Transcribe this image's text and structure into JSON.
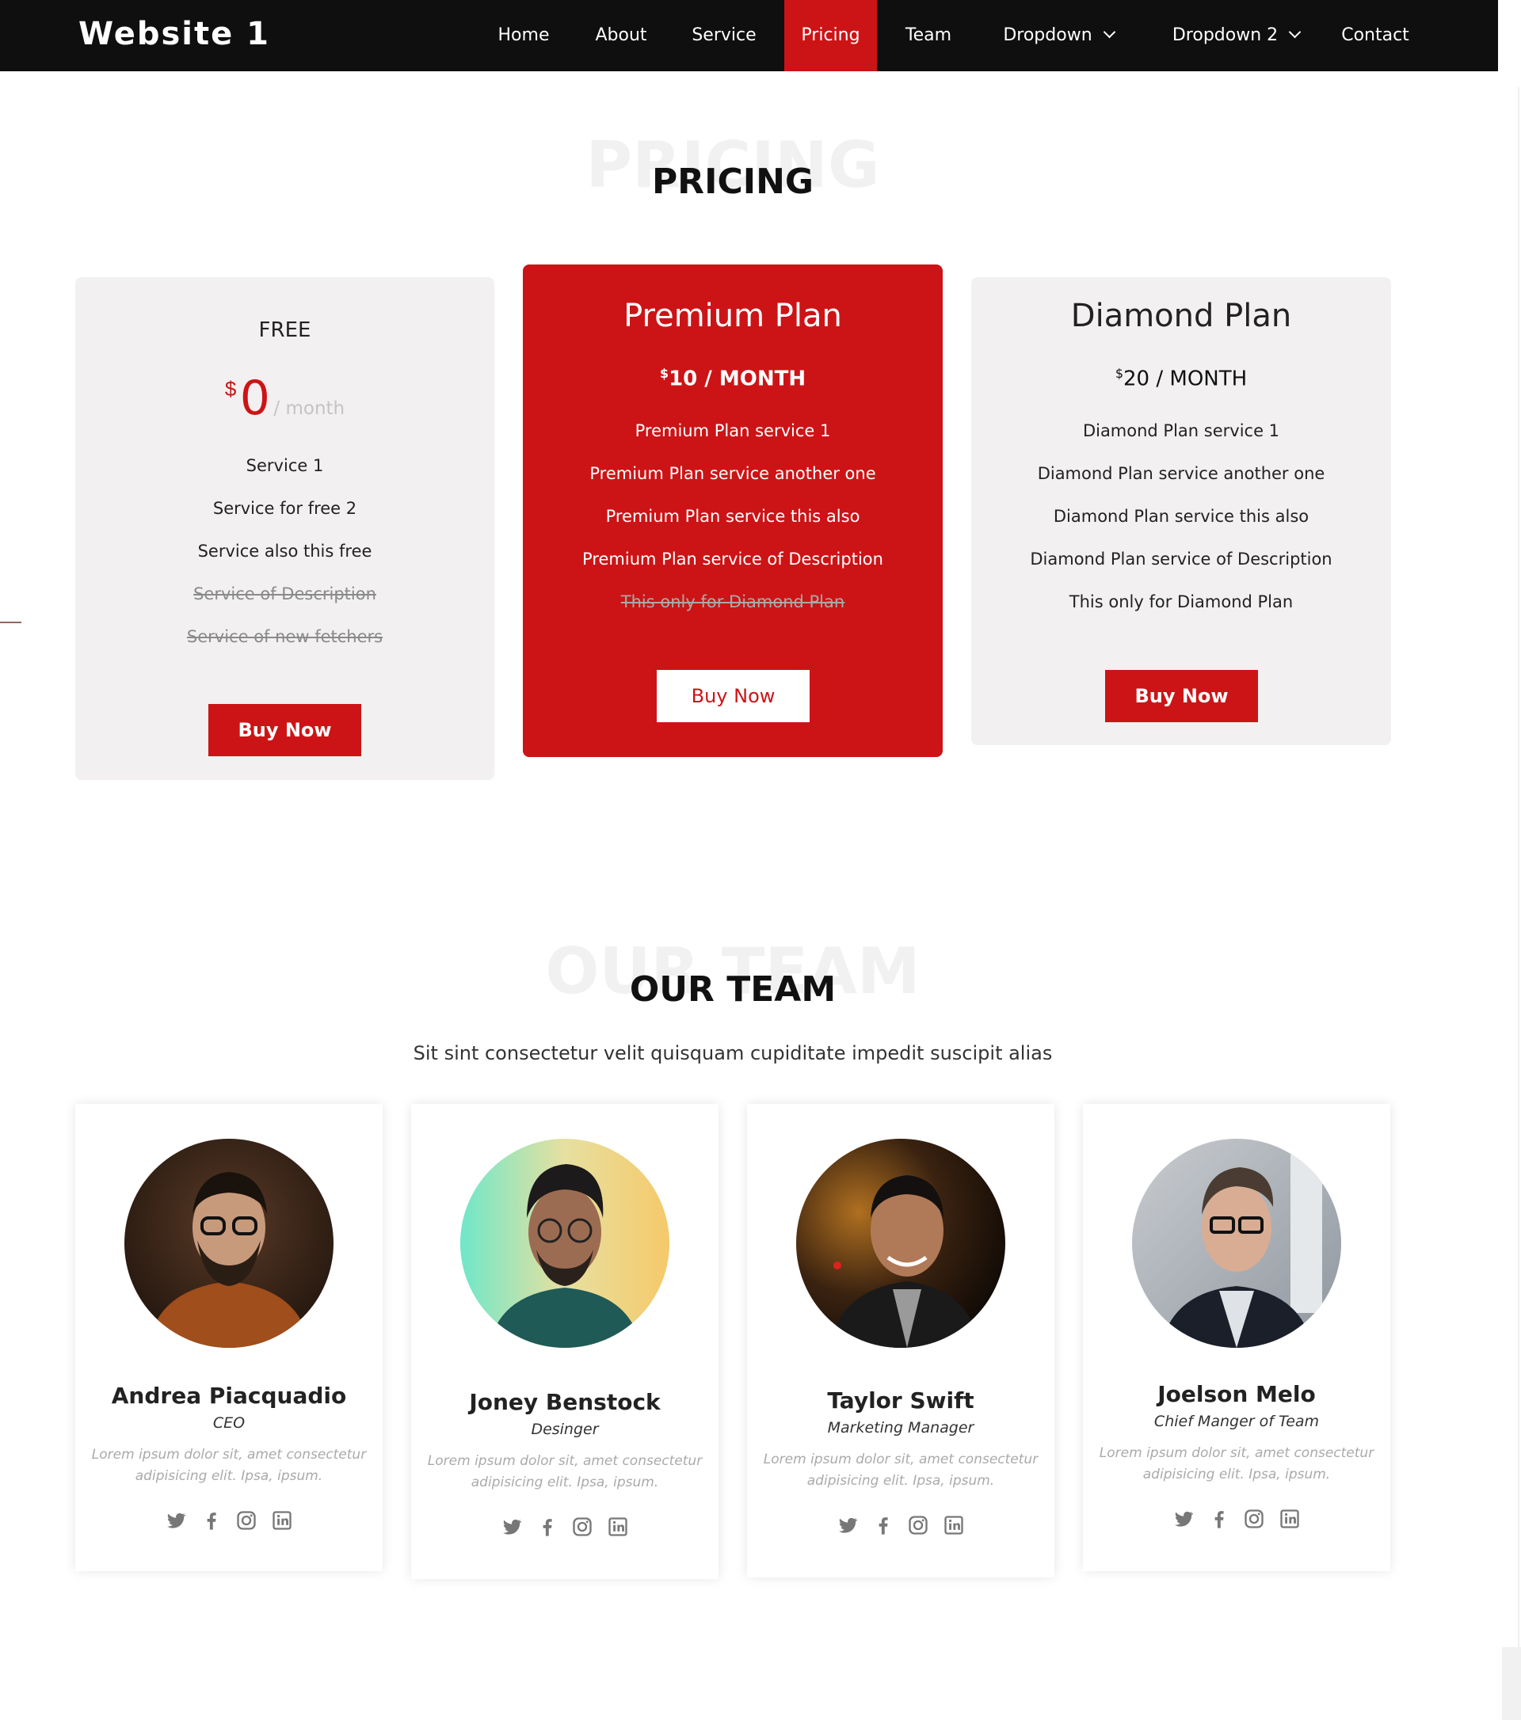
{
  "header": {
    "brand": "Website 1",
    "nav": [
      {
        "label": "Home"
      },
      {
        "label": "About"
      },
      {
        "label": "Service"
      },
      {
        "label": "Pricing",
        "active": true
      },
      {
        "label": "Team"
      },
      {
        "label": "Dropdown"
      },
      {
        "label": "Dropdown 2"
      },
      {
        "label": "Contact"
      }
    ]
  },
  "pricing": {
    "title_bg": "PRICING",
    "title": "PRICING",
    "plans": [
      {
        "name": "FREE",
        "currency": "$",
        "price": "0",
        "period": "/ month",
        "features": [
          "Service 1",
          "Service for free 2",
          "Service also this free"
        ],
        "disabled_features": [
          "Service of Description",
          "Service of new fetchers"
        ],
        "button": "Buy Now"
      },
      {
        "name": "Premium Plan",
        "currency": "$",
        "price_text": "10 / MONTH",
        "features": [
          "Premium Plan service 1",
          "Premium Plan service another one",
          "Premium Plan service this also",
          "Premium Plan service of Description"
        ],
        "disabled_features": [
          "This only for Diamond Plan"
        ],
        "button": "Buy Now"
      },
      {
        "name": "Diamond Plan",
        "currency": "$",
        "price_text": "20 / MONTH",
        "features": [
          "Diamond Plan service 1",
          "Diamond Plan service another one",
          "Diamond Plan service this also",
          "Diamond Plan service of Description",
          "This only for Diamond Plan"
        ],
        "button": "Buy Now"
      }
    ]
  },
  "team": {
    "title_bg": "OUR TEAM",
    "title": "OUR TEAM",
    "subtitle": "Sit sint consectetur velit quisquam cupiditate impedit suscipit alias",
    "members": [
      {
        "name": "Andrea Piacquadio",
        "role": "CEO",
        "desc": "Lorem ipsum dolor sit, amet consectetur adipisicing elit. Ipsa, ipsum."
      },
      {
        "name": "Joney Benstock",
        "role": "Desinger",
        "desc": "Lorem ipsum dolor sit, amet consectetur adipisicing elit. Ipsa, ipsum."
      },
      {
        "name": "Taylor Swift",
        "role": "Marketing Manager",
        "desc": "Lorem ipsum dolor sit, amet consectetur adipisicing elit. Ipsa, ipsum."
      },
      {
        "name": "Joelson Melo",
        "role": "Chief Manger of Team",
        "desc": "Lorem ipsum dolor sit, amet consectetur adipisicing elit. Ipsa, ipsum."
      }
    ],
    "social_icons": [
      "twitter-icon",
      "facebook-icon",
      "instagram-icon",
      "linkedin-icon"
    ]
  },
  "colors": {
    "accent": "#cc1417",
    "header_bg": "#0f0f0f",
    "card_grey": "#f2f0f0"
  }
}
